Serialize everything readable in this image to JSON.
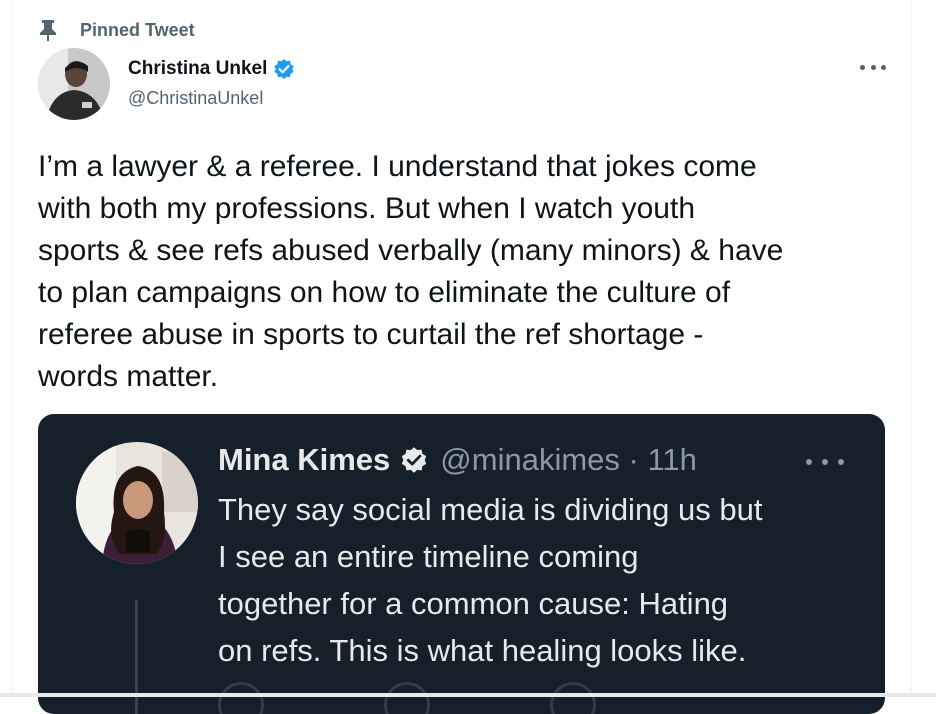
{
  "pinned": {
    "label": "Pinned Tweet",
    "icon": "pin-icon"
  },
  "author": {
    "name": "Christina Unkel",
    "handle": "@ChristinaUnkel",
    "verified_icon": "verified-badge-icon",
    "more_icon": "more-options-icon"
  },
  "tweet": {
    "text": "I’m a lawyer & a referee. I understand that jokes come\nwith both my professions. But when I watch youth\nsports & see refs abused verbally (many minors) & have\nto plan campaigns on how to eliminate the culture of\nreferee abuse in sports to curtail the ref shortage -\nwords matter."
  },
  "quoted_tweet": {
    "name": "Mina Kimes",
    "handle_time": "@minakimes · 11h",
    "verified_icon": "verified-badge-icon",
    "more_icon": "more-options-icon",
    "text": "They say social media is dividing us but\nI see an entire timeline coming\ntogether for a common cause: Hating\non refs. This is what healing looks like."
  },
  "colors": {
    "accent": "#1d9bf0",
    "text_primary": "#0f1419",
    "text_secondary": "#536471",
    "quote_background": "#15202b",
    "quote_text": "#e7e9ea",
    "quote_secondary": "#8b98a5"
  }
}
